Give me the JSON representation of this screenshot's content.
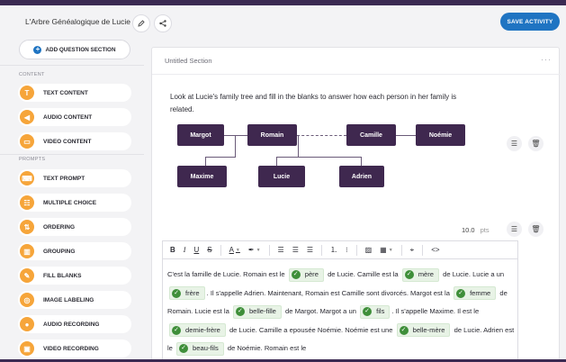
{
  "header": {
    "title": "L'Arbre Généalogique de Lucie",
    "save_label": "SAVE ACTIVITY"
  },
  "sidebar": {
    "add_section_label": "ADD QUESTION SECTION",
    "content_label": "CONTENT",
    "prompts_label": "PROMPTS",
    "content_items": [
      {
        "label": "TEXT CONTENT",
        "icon": "text-icon"
      },
      {
        "label": "AUDIO CONTENT",
        "icon": "speaker-icon"
      },
      {
        "label": "VIDEO CONTENT",
        "icon": "video-icon"
      }
    ],
    "prompt_items": [
      {
        "label": "TEXT PROMPT",
        "icon": "text-prompt-icon"
      },
      {
        "label": "MULTIPLE CHOICE",
        "icon": "multiple-choice-icon"
      },
      {
        "label": "ORDERING",
        "icon": "ordering-icon"
      },
      {
        "label": "GROUPING",
        "icon": "grouping-icon"
      },
      {
        "label": "FILL BLANKS",
        "icon": "fill-blanks-icon"
      },
      {
        "label": "IMAGE LABELING",
        "icon": "image-label-icon"
      },
      {
        "label": "AUDIO RECORDING",
        "icon": "microphone-icon"
      },
      {
        "label": "VIDEO RECORDING",
        "icon": "video-recording-icon"
      }
    ]
  },
  "section": {
    "title": "Untitled Section",
    "prompt": "Look at Lucie's family tree and fill in the blanks to answer how each person in her family is related.",
    "tree": {
      "margot": "Margot",
      "romain": "Romain",
      "camille": "Camille",
      "noemie": "Noémie",
      "maxime": "Maxime",
      "lucie": "Lucie",
      "adrien": "Adrien"
    },
    "points": "10.0",
    "points_unit": "pts"
  },
  "editor": {
    "toolbar": [
      "B",
      "I",
      "U",
      "S",
      "A",
      "highlight",
      "align-left",
      "align-center",
      "align-right",
      "ordered-list",
      "bullet-list",
      "image",
      "table",
      "blank",
      "code"
    ],
    "text": {
      "t1": "C'est la famille de Lucie. Romain est le",
      "b1": "père",
      "t2": "de Lucie. Camille est la",
      "b2": "mère",
      "t3": "de Lucie. Lucie a un",
      "b3": "frère",
      "t4": ". Il s'appelle Adrien. Maintenant, Romain est Camille sont divorcés. Margot est la",
      "b4": "femme",
      "t5": "de Romain. Lucie est la",
      "b5": "belle-fille",
      "t6": "de Margot. Margot a un",
      "b6": "fils",
      "t7": ". Il s'appelle Maxime. Il est le",
      "b7": "demie-frère",
      "t8": "de Lucie. Camille a epousée Noémie. Noémie est une",
      "b8": "belle-mère",
      "t9": "de Lucie. Adrien est le",
      "b9": "beau-fils",
      "t10": "de Noémie. Romain est le"
    }
  }
}
